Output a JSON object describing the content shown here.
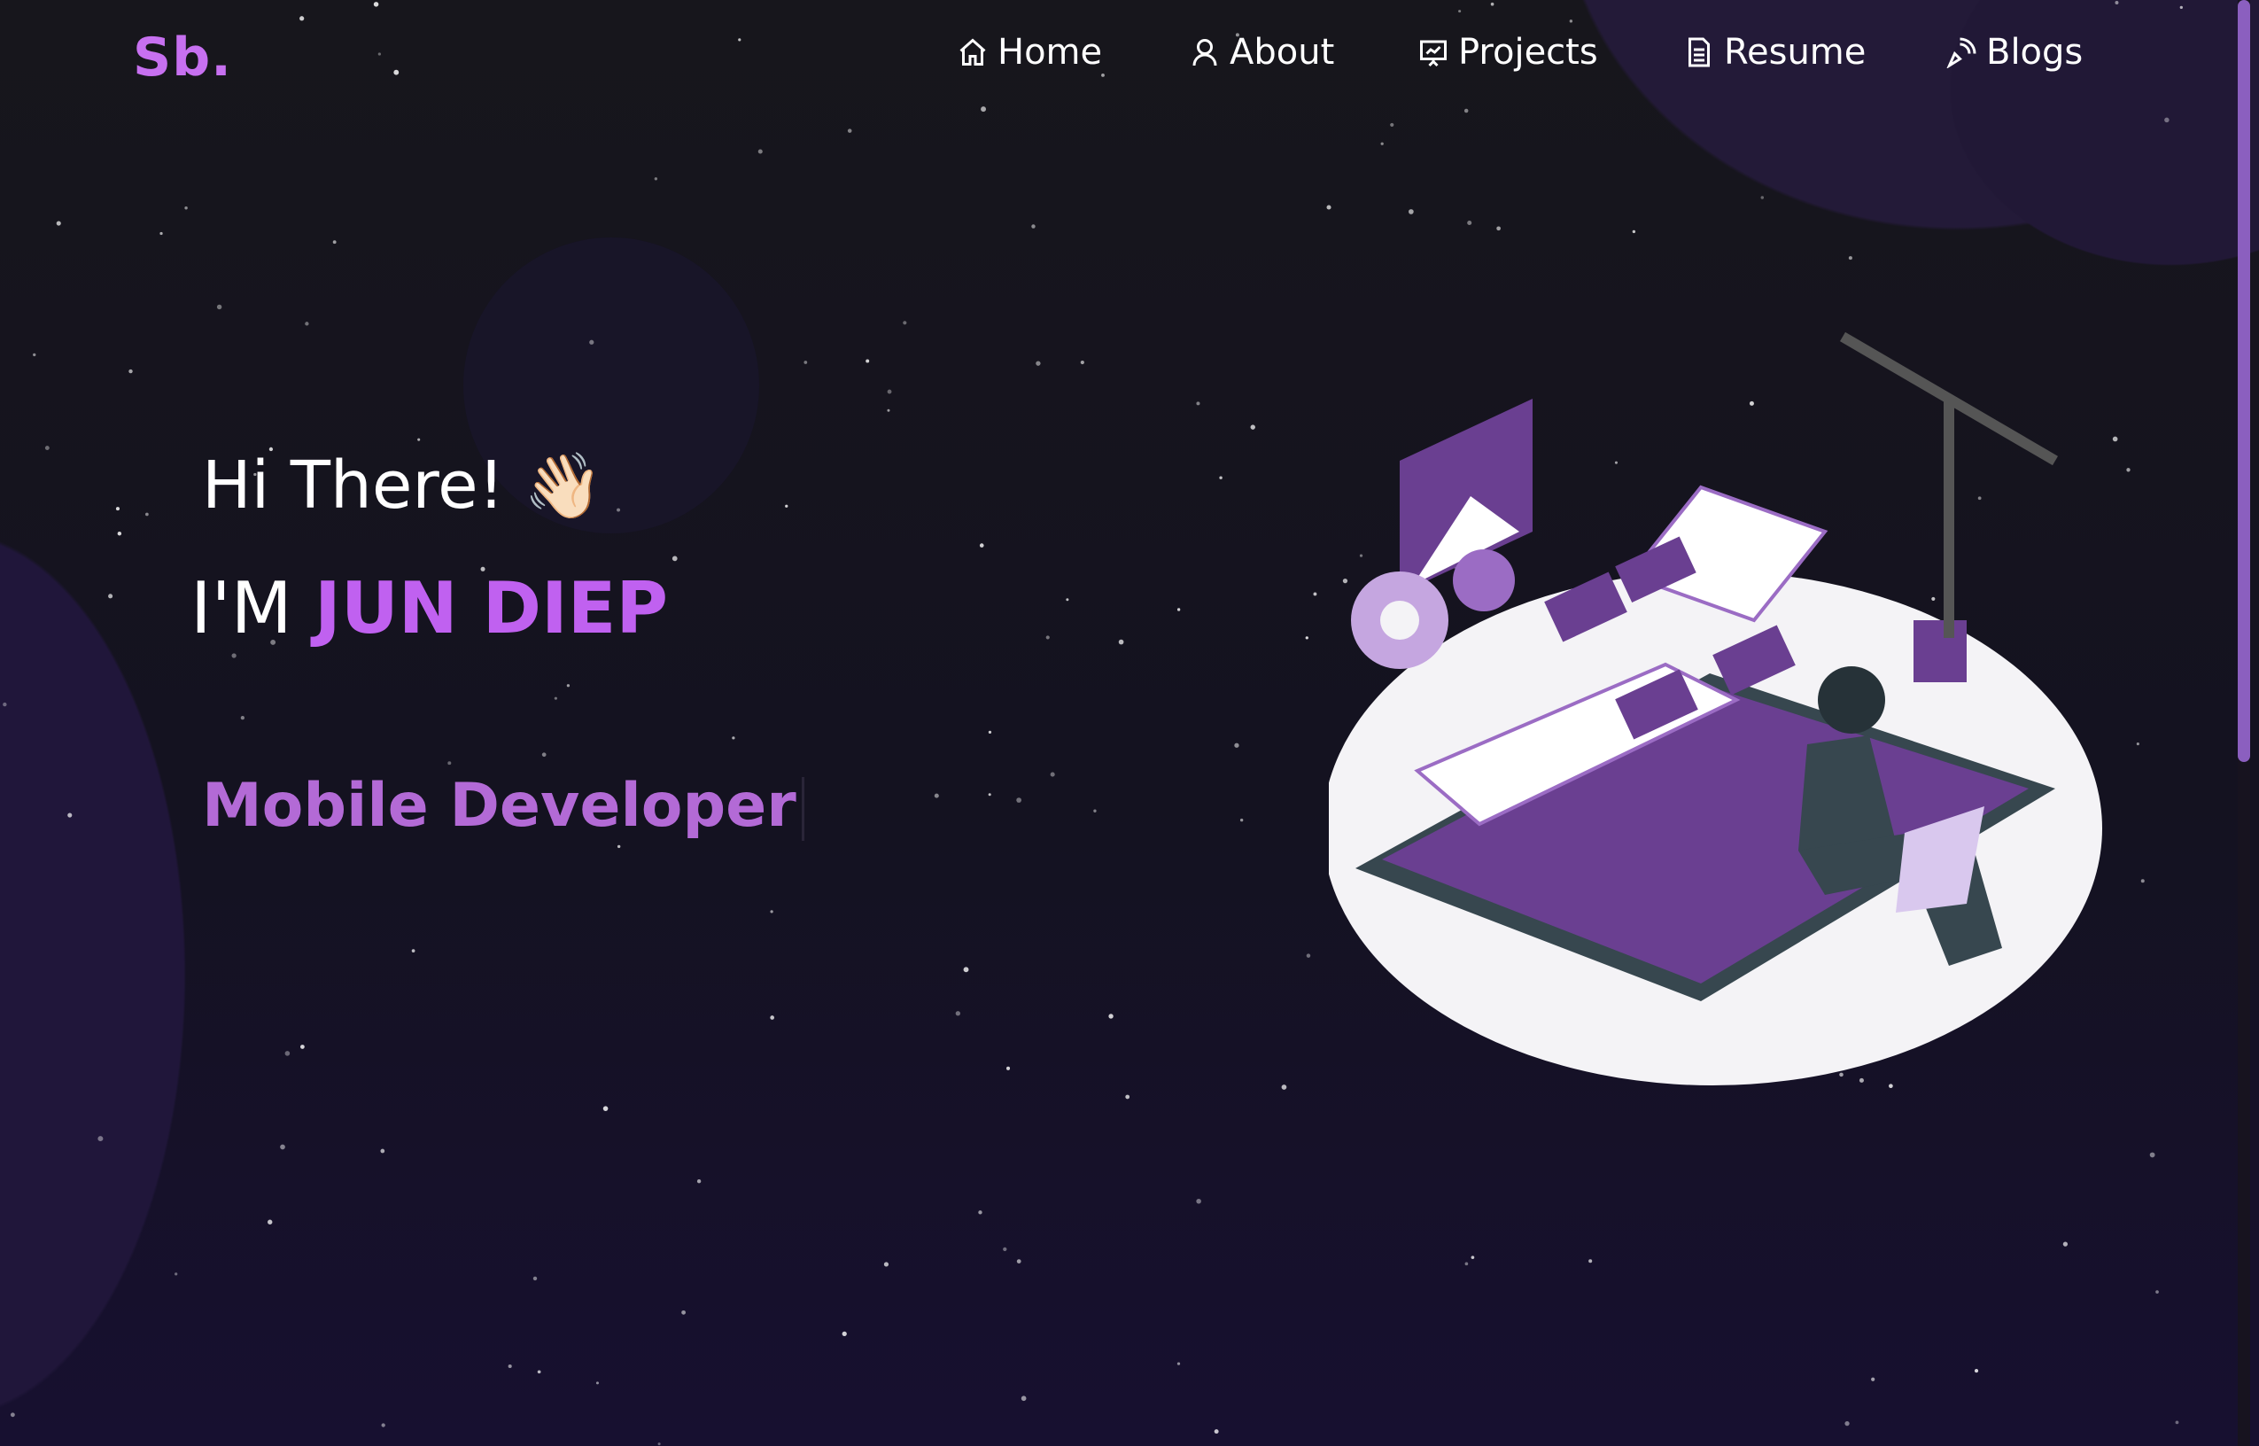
{
  "brand": {
    "logo": "Sb."
  },
  "nav": {
    "items": [
      {
        "label": "Home",
        "icon": "home-icon"
      },
      {
        "label": "About",
        "icon": "user-icon"
      },
      {
        "label": "Projects",
        "icon": "presentation-icon"
      },
      {
        "label": "Resume",
        "icon": "document-icon"
      },
      {
        "label": "Blogs",
        "icon": "pen-rss-icon"
      }
    ]
  },
  "hero": {
    "greeting": "Hi There!",
    "wave": "👋🏻",
    "im": "I'M",
    "name": "JUN DIEP",
    "role": "Mobile Developer"
  },
  "colors": {
    "accent": "#c770f0",
    "role": "#b36ad6",
    "scroll": "#8b5fbf"
  }
}
